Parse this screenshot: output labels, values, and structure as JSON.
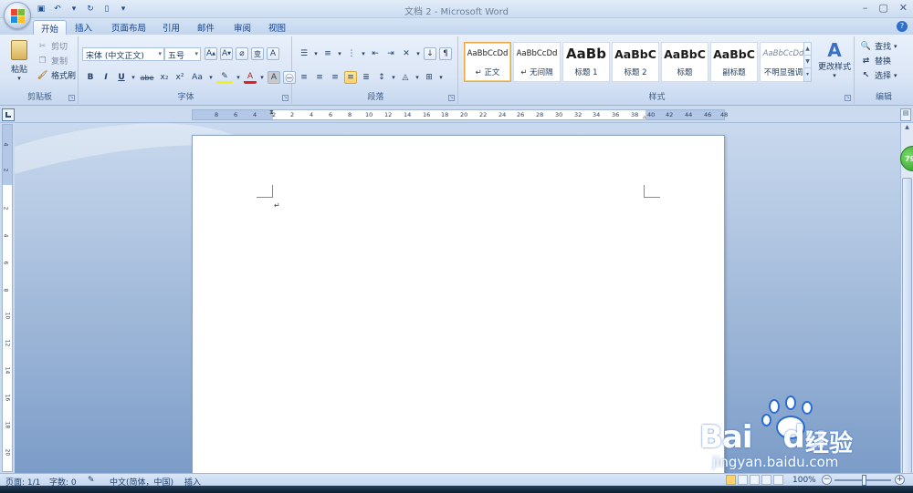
{
  "window": {
    "title": "文档 2 - Microsoft Word"
  },
  "tabs": [
    "开始",
    "插入",
    "页面布局",
    "引用",
    "邮件",
    "审阅",
    "视图"
  ],
  "clipboard": {
    "paste": "粘贴",
    "cut": "剪切",
    "copy": "复制",
    "format_painter": "格式刷",
    "label": "剪贴板"
  },
  "font": {
    "name": "宋体 (中文正文)",
    "size": "五号",
    "label": "字体",
    "buttons": [
      "B",
      "I",
      "U",
      "abe",
      "x₂",
      "x²",
      "Aa"
    ]
  },
  "paragraph": {
    "label": "段落"
  },
  "styles": {
    "label": "样式",
    "items": [
      {
        "sample": "AaBbCcDd",
        "name": "↵ 正文"
      },
      {
        "sample": "AaBbCcDd",
        "name": "↵ 无间隔"
      },
      {
        "sample": "AaBb",
        "name": "标题 1"
      },
      {
        "sample": "AaBbC",
        "name": "标题 2"
      },
      {
        "sample": "AaBbC",
        "name": "标题"
      },
      {
        "sample": "AaBbC",
        "name": "副标题"
      },
      {
        "sample": "AaBbCcDd",
        "name": "不明显强调"
      }
    ],
    "change_styles": "更改样式"
  },
  "editing": {
    "find": "查找",
    "replace": "替换",
    "select": "选择",
    "label": "编辑"
  },
  "ruler": {
    "numbers": [
      "8",
      "6",
      "4",
      "2",
      "2",
      "4",
      "6",
      "8",
      "10",
      "12",
      "14",
      "16",
      "18",
      "20",
      "22",
      "24",
      "26",
      "28",
      "30",
      "32",
      "34",
      "36",
      "38",
      "40",
      "42",
      "44",
      "46",
      "48"
    ],
    "vnumbers": [
      "4",
      "2",
      "2",
      "4",
      "6",
      "8",
      "10",
      "12",
      "14",
      "16",
      "18",
      "20"
    ]
  },
  "document": {
    "paragraph_mark": "↵"
  },
  "zoom_badge": "79",
  "statusbar": {
    "page": "页面: 1/1",
    "words": "字数: 0",
    "language": "中文(简体，中国)",
    "mode": "插入",
    "zoom": "100%"
  },
  "watermark": {
    "brand": "Bai",
    "brand_tail": "du",
    "cn": "经验",
    "url": "jingyan.baidu.com"
  }
}
